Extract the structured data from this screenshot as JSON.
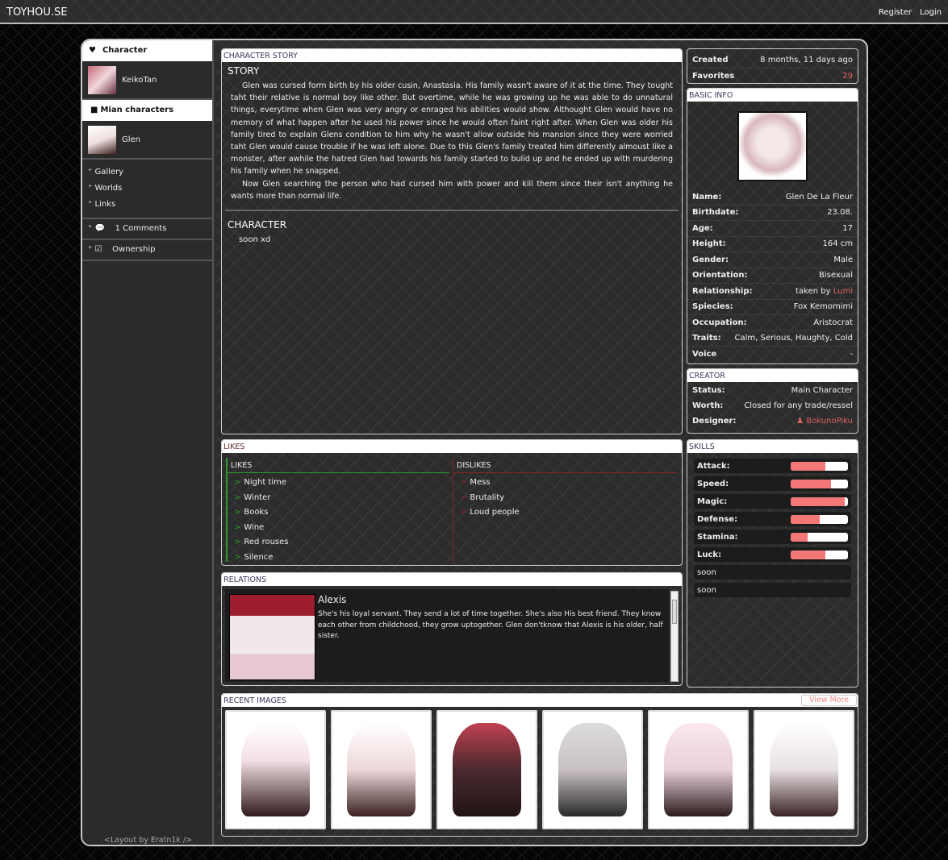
{
  "nav": {
    "brand": "TOYHOU.SE",
    "register": "Register",
    "login": "Login"
  },
  "sidebar": {
    "character_header": "Character",
    "owner": "KeikoTan",
    "main_header": "Mian characters",
    "main_char": "Glen",
    "links": [
      "Gallery",
      "Worlds",
      "Links"
    ],
    "comments": "1 Comments",
    "ownership": "Ownership",
    "footer": "<Layout by Eratn1k />"
  },
  "story": {
    "panel_title": "CHARACTER STORY",
    "story_heading": "STORY",
    "paragraphs": [
      "Glen was cursed form birth by his older cusin, Anastasia. His family wasn't aware of it at the time. They tought taht their relative is normal boy like other. But overtime, while he was growing up he was able to do unnatural things, everytime when Glen was very angry or enraged his abilities would show. Althought Glen would have no memory of what happen after he used his power since he would often faint right after. When Glen was older his family tired to explain Glens condition to him why he wasn't allow outside his mansion since they were worried taht Glen would cause trouble if he was left alone. Due to this Glen's family treated him differently almoust like a monster, after awhile the hatred Glen had towards his family started to bulid up and he ended up with murdering his family when he snapped.",
      "Now Glen searching the person who had cursed him with power and kill them since their isn't anything he wants more than normal life."
    ],
    "character_heading": "CHARACTER",
    "character_text": "soon xd"
  },
  "stats": {
    "created_label": "Created",
    "created": "8 months, 11 days ago",
    "favorites_label": "Favorites",
    "favorites": "29"
  },
  "basic_info": {
    "title": "BASIC INFO",
    "rows": [
      {
        "k": "Name:",
        "v": "Glen De La Fleur"
      },
      {
        "k": "Birthdate:",
        "v": "23.08."
      },
      {
        "k": "Age:",
        "v": "17"
      },
      {
        "k": "Height:",
        "v": "164 cm"
      },
      {
        "k": "Gender:",
        "v": "Male"
      },
      {
        "k": "Orientation:",
        "v": "Bisexual"
      },
      {
        "k": "Relationship:",
        "v": "taken by ",
        "link": "Lumi"
      },
      {
        "k": "Spiecies:",
        "v": "Fox Kemomimi"
      },
      {
        "k": "Occupation:",
        "v": "Aristocrat"
      },
      {
        "k": "Traits:",
        "v": "Calm, Serious, Haughty, Cold"
      },
      {
        "k": "Voice",
        "v": "-"
      }
    ]
  },
  "creator": {
    "title": "CREATOR",
    "rows": [
      {
        "k": "Status:",
        "v": "Main Character"
      },
      {
        "k": "Worth:",
        "v": "Closed for any trade/ressel"
      },
      {
        "k": "Designer:",
        "v": "BokunoPiku"
      }
    ]
  },
  "likes": {
    "title": "LIKES",
    "likes_heading": "LIKES",
    "likes": [
      "Night time",
      "Winter",
      "Books",
      "Wine",
      "Red rouses",
      "Silence"
    ],
    "dislikes_heading": "DISLIKES",
    "dislikes": [
      "Mess",
      "Brutality",
      "Loud people"
    ],
    "marker": ">"
  },
  "skills": {
    "title": "SKILLS",
    "items": [
      {
        "name": "Attack:",
        "percent": 60
      },
      {
        "name": "Speed:",
        "percent": 70
      },
      {
        "name": "Magic:",
        "percent": 95
      },
      {
        "name": "Defense:",
        "percent": 50
      },
      {
        "name": "Stamina:",
        "percent": 30
      },
      {
        "name": "Luck:",
        "percent": 60
      }
    ],
    "extra": [
      "soon",
      "soon"
    ]
  },
  "relations": {
    "title": "RELATIONS",
    "name": "Alexis",
    "text": "She's his loyal servant. They send a lot of time together. She's also His best friend. They know each other from childchood, they grow uptogether. Glen don'tknow that Alexis is his older, half sister."
  },
  "recent": {
    "title": "RECENT IMAGES",
    "view_more": "View More",
    "count": 6
  },
  "colors": {
    "accent": "#e06060",
    "likes": "#2a9a2a",
    "dislikes": "#8a2222",
    "skill_bar": "#f37777"
  }
}
